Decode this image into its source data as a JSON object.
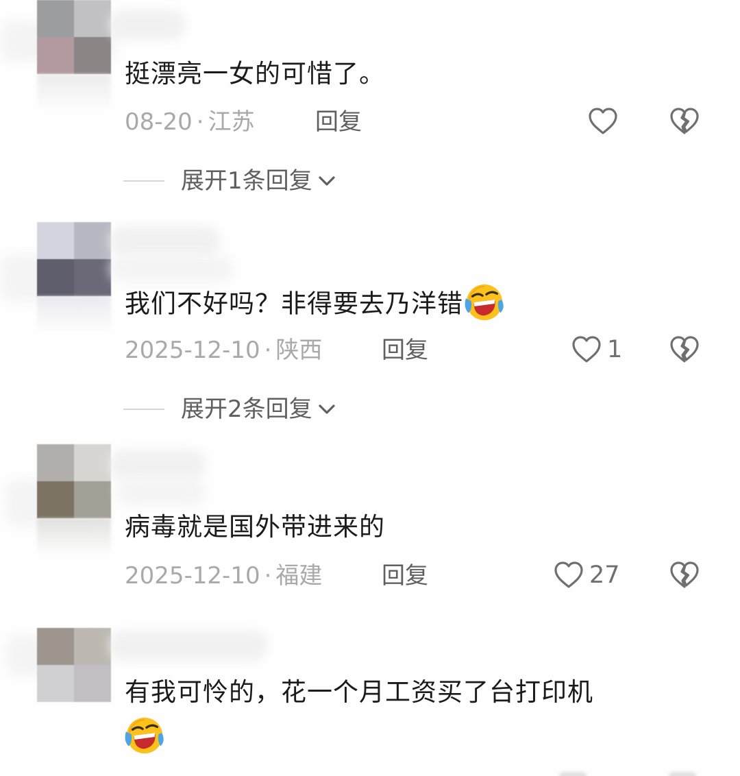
{
  "comments": [
    {
      "text": "挺漂亮一女的可惜了。",
      "date": "08-20",
      "location": "江苏",
      "reply_label": "回复",
      "likes": "",
      "expand_label": "展开1条回复",
      "avatar_colors": [
        "#9c9d9f",
        "#c1c1c3",
        "#b39a9f",
        "#8c8586"
      ]
    },
    {
      "text": "我们不好吗？非得要去乃洋错",
      "date": "2025-12-10",
      "location": "陕西",
      "reply_label": "回复",
      "likes": "1",
      "expand_label": "展开2条回复",
      "avatar_colors": [
        "#d3d5de",
        "#b7b9c2",
        "#5f5e6c",
        "#6b6977"
      ]
    },
    {
      "text": "病毒就是国外带进来的",
      "date": "2025-12-10",
      "location": "福建",
      "reply_label": "回复",
      "likes": "27",
      "expand_label": "",
      "avatar_colors": [
        "#b1afab",
        "#d7d6d2",
        "#7c7364",
        "#a29f96"
      ]
    },
    {
      "text": "有我可怜的，花一个月工资买了台打印机",
      "date": "",
      "location": "",
      "reply_label": "",
      "likes": "",
      "expand_label": "",
      "avatar_colors": [
        "#9e958f",
        "#bdb8b2",
        "#d0cfd2",
        "#c1bfc3"
      ]
    }
  ],
  "separator_dot": "·",
  "icons": {
    "like": "heart-outline-icon",
    "dislike": "broken-heart-icon",
    "expand": "chevron-down-icon",
    "emoji": "laughing-crying-face-emoji"
  },
  "colors": {
    "background": "#fefefe",
    "text_primary": "#1b1b1b",
    "text_meta": "#a9a9a9",
    "text_secondary": "#5f5f5f",
    "icon_gray": "#6f6f6f"
  }
}
